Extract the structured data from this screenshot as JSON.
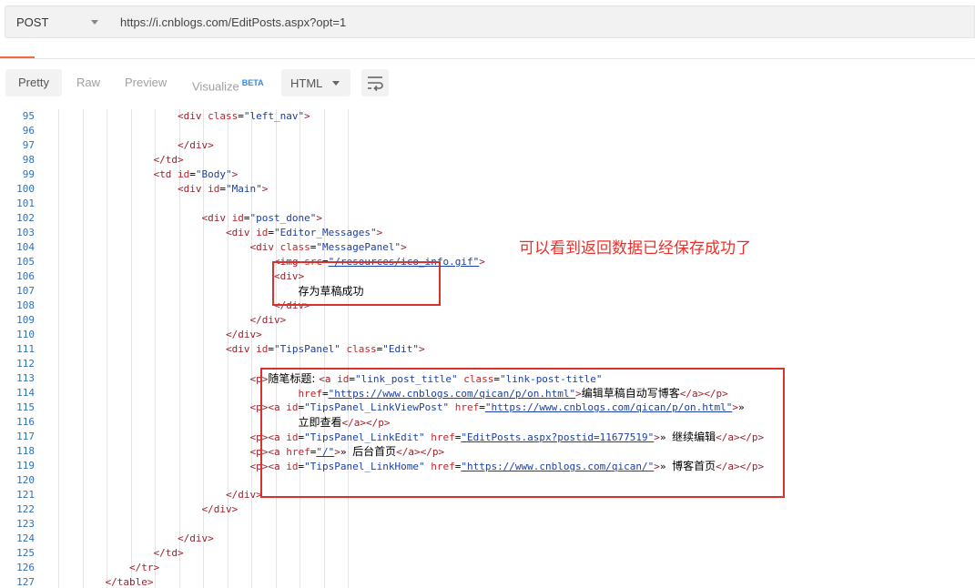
{
  "request": {
    "method": "POST",
    "url": "https://i.cnblogs.com/EditPosts.aspx?opt=1"
  },
  "response_toolbar": {
    "tabs": [
      "Pretty",
      "Raw",
      "Preview",
      "Visualize"
    ],
    "beta": "BETA",
    "format": "HTML"
  },
  "annotation": "可以看到返回数据已经保存成功了",
  "code_lines": [
    {
      "n": "95",
      "indent": 8,
      "html": "<span class='tag'>&lt;div</span> <span class='attr'>class</span>=<span class='val'>\"left_nav\"</span><span class='tag'>&gt;</span>"
    },
    {
      "n": "96",
      "indent": 0,
      "html": ""
    },
    {
      "n": "97",
      "indent": 8,
      "html": "<span class='tag'>&lt;/div&gt;</span>"
    },
    {
      "n": "98",
      "indent": 7,
      "html": "<span class='tag'>&lt;/td&gt;</span>"
    },
    {
      "n": "99",
      "indent": 7,
      "html": "<span class='tag'>&lt;td</span> <span class='attr'>id</span>=<span class='val'>\"Body\"</span><span class='tag'>&gt;</span>"
    },
    {
      "n": "100",
      "indent": 8,
      "html": "<span class='tag'>&lt;div</span> <span class='attr'>id</span>=<span class='val'>\"Main\"</span><span class='tag'>&gt;</span>"
    },
    {
      "n": "101",
      "indent": 0,
      "html": ""
    },
    {
      "n": "102",
      "indent": 9,
      "html": "<span class='tag'>&lt;div</span> <span class='attr'>id</span>=<span class='val'>\"post_done\"</span><span class='tag'>&gt;</span>"
    },
    {
      "n": "103",
      "indent": 10,
      "html": "<span class='tag'>&lt;div</span> <span class='attr'>id</span>=<span class='val'>\"Editor_Messages\"</span><span class='tag'>&gt;</span>"
    },
    {
      "n": "104",
      "indent": 11,
      "html": "<span class='tag'>&lt;div</span> <span class='attr'>class</span>=<span class='val'>\"MessagePanel\"</span><span class='tag'>&gt;</span>"
    },
    {
      "n": "105",
      "indent": 12,
      "html": "<span class='tag'>&lt;img</span> <span class='attr'>src</span>=<span class='link'>\"/resources/ico_info.gif\"</span><span class='tag'>&gt;</span>"
    },
    {
      "n": "106",
      "indent": 12,
      "html": "<span class='tag'>&lt;div&gt;</span>"
    },
    {
      "n": "107",
      "indent": 13,
      "html": "<span class='cn'>存为草稿成功</span>"
    },
    {
      "n": "108",
      "indent": 12,
      "html": "<span class='tag'>&lt;/div&gt;</span>"
    },
    {
      "n": "109",
      "indent": 11,
      "html": "<span class='tag'>&lt;/div&gt;</span>"
    },
    {
      "n": "110",
      "indent": 10,
      "html": "<span class='tag'>&lt;/div&gt;</span>"
    },
    {
      "n": "111",
      "indent": 10,
      "html": "<span class='tag'>&lt;div</span> <span class='attr'>id</span>=<span class='val'>\"TipsPanel\"</span> <span class='attr'>class</span>=<span class='val'>\"Edit\"</span><span class='tag'>&gt;</span>"
    },
    {
      "n": "112",
      "indent": 0,
      "html": ""
    },
    {
      "n": "113",
      "indent": 11,
      "html": "<span class='tag'>&lt;p&gt;</span><span class='cn'>随笔标题: </span><span class='tag'>&lt;a</span> <span class='attr'>id</span>=<span class='val'>\"link_post_title\"</span> <span class='attr'>class</span>=<span class='val'>\"link-post-title\"</span>"
    },
    {
      "n": "114",
      "indent": 13,
      "html": "<span class='attr'>href</span>=<span class='link'>\"https://www.cnblogs.com/qican/p/on.html\"</span><span class='tag'>&gt;</span><span class='cn'>编辑草稿自动写博客</span><span class='tag'>&lt;/a&gt;&lt;/p&gt;</span>"
    },
    {
      "n": "115",
      "indent": 11,
      "html": "<span class='tag'>&lt;p&gt;&lt;a</span> <span class='attr'>id</span>=<span class='val'>\"TipsPanel_LinkViewPost\"</span> <span class='attr'>href</span>=<span class='link'>\"https://www.cnblogs.com/qican/p/on.html\"</span><span class='tag'>&gt;</span>»"
    },
    {
      "n": "116",
      "indent": 13,
      "html": "<span class='cn'>立即查看</span><span class='tag'>&lt;/a&gt;&lt;/p&gt;</span>"
    },
    {
      "n": "117",
      "indent": 11,
      "html": "<span class='tag'>&lt;p&gt;&lt;a</span> <span class='attr'>id</span>=<span class='val'>\"TipsPanel_LinkEdit\"</span> <span class='attr'>href</span>=<span class='link'>\"EditPosts.aspx?postid=11677519\"</span><span class='tag'>&gt;</span>» <span class='cn'>继续编辑</span><span class='tag'>&lt;/a&gt;&lt;/p&gt;</span>"
    },
    {
      "n": "118",
      "indent": 11,
      "html": "<span class='tag'>&lt;p&gt;&lt;a</span> <span class='attr'>href</span>=<span class='link'>\"/\"</span><span class='tag'>&gt;</span>» <span class='cn'>后台首页</span><span class='tag'>&lt;/a&gt;&lt;/p&gt;</span>"
    },
    {
      "n": "119",
      "indent": 11,
      "html": "<span class='tag'>&lt;p&gt;&lt;a</span> <span class='attr'>id</span>=<span class='val'>\"TipsPanel_LinkHome\"</span> <span class='attr'>href</span>=<span class='link'>\"https://www.cnblogs.com/qican/\"</span><span class='tag'>&gt;</span>» <span class='cn'>博客首页</span><span class='tag'>&lt;/a&gt;&lt;/p&gt;</span>"
    },
    {
      "n": "120",
      "indent": 0,
      "html": ""
    },
    {
      "n": "121",
      "indent": 10,
      "html": "<span class='tag'>&lt;/div&gt;</span>"
    },
    {
      "n": "122",
      "indent": 9,
      "html": "<span class='tag'>&lt;/div&gt;</span>"
    },
    {
      "n": "123",
      "indent": 0,
      "html": ""
    },
    {
      "n": "124",
      "indent": 8,
      "html": "<span class='tag'>&lt;/div&gt;</span>"
    },
    {
      "n": "125",
      "indent": 7,
      "html": "<span class='tag'>&lt;/td&gt;</span>"
    },
    {
      "n": "126",
      "indent": 6,
      "html": "<span class='tag'>&lt;/tr&gt;</span>"
    },
    {
      "n": "127",
      "indent": 5,
      "html": "<span class='tag'>&lt;/table&gt;</span>"
    }
  ]
}
